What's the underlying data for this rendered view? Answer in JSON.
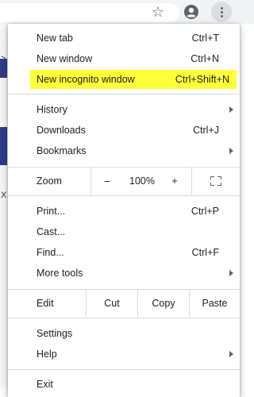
{
  "toolbar": {
    "icons": [
      "star-icon",
      "account-icon",
      "more-vert-icon"
    ]
  },
  "page": {
    "fragments": [
      ">",
      "X"
    ]
  },
  "colors": {
    "highlight": "#ffff3a",
    "page_accent": "#2d3e8b"
  },
  "menu": {
    "new_tab": {
      "label": "New tab",
      "shortcut": "Ctrl+T"
    },
    "new_window": {
      "label": "New window",
      "shortcut": "Ctrl+N"
    },
    "new_incognito": {
      "label": "New incognito window",
      "shortcut": "Ctrl+Shift+N"
    },
    "history": {
      "label": "History"
    },
    "downloads": {
      "label": "Downloads",
      "shortcut": "Ctrl+J"
    },
    "bookmarks": {
      "label": "Bookmarks"
    },
    "zoom": {
      "label": "Zoom",
      "minus": "–",
      "value": "100%",
      "plus": "+"
    },
    "print": {
      "label": "Print...",
      "shortcut": "Ctrl+P"
    },
    "cast": {
      "label": "Cast..."
    },
    "find": {
      "label": "Find...",
      "shortcut": "Ctrl+F"
    },
    "more_tools": {
      "label": "More tools"
    },
    "edit": {
      "label": "Edit",
      "cut": "Cut",
      "copy": "Copy",
      "paste": "Paste"
    },
    "settings": {
      "label": "Settings"
    },
    "help": {
      "label": "Help"
    },
    "exit": {
      "label": "Exit"
    }
  }
}
